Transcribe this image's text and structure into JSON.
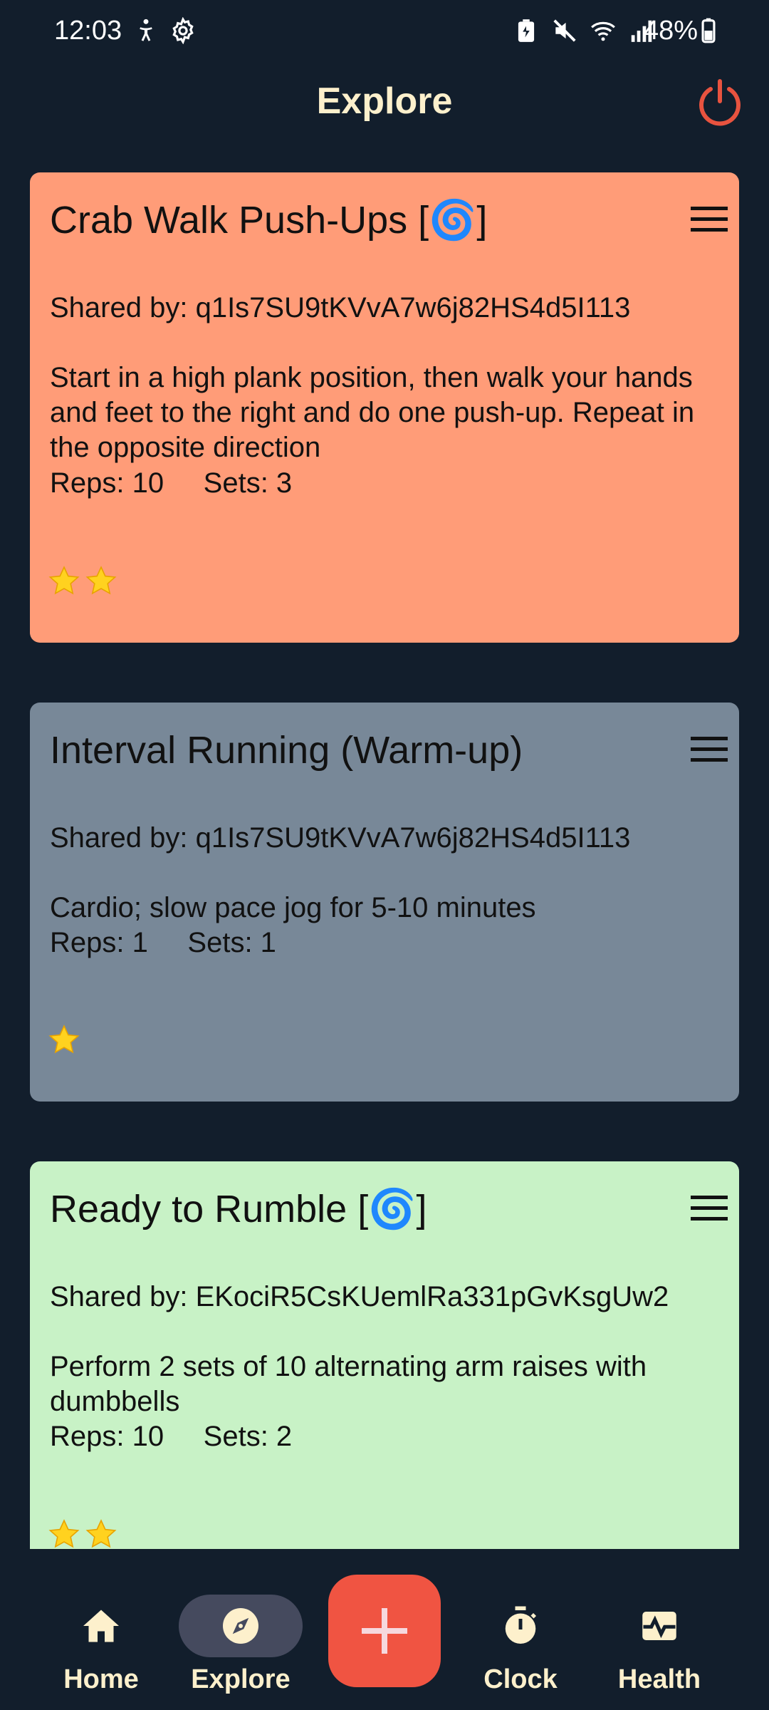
{
  "status_bar": {
    "time": "12:03",
    "battery": "48%",
    "icons": [
      "accessibility-icon",
      "settings-gear-icon",
      "battery-saver-icon",
      "mute-icon",
      "wifi-icon",
      "signal-icon",
      "battery-icon"
    ]
  },
  "header": {
    "title": "Explore",
    "power_icon": "power-icon",
    "power_color": "#e8533f"
  },
  "cards": [
    {
      "title": "Crab Walk Push-Ups [",
      "emoji": "🌀",
      "title_suffix": "]",
      "shared_by": "Shared by: q1Is7SU9tKVvA7w6j82HS4d5I113",
      "description": "Start in a high plank position, then walk your hands and feet to the right and do one push-up. Repeat in the opposite direction",
      "stats": "Reps: 10     Sets: 3",
      "stars": 2,
      "color": "#ff9c78"
    },
    {
      "title": "Interval Running (Warm-up)",
      "emoji": "",
      "title_suffix": "",
      "shared_by": "Shared by: q1Is7SU9tKVvA7w6j82HS4d5I113",
      "description": "Cardio; slow pace jog for 5-10 minutes",
      "stats": "Reps: 1     Sets: 1",
      "stars": 1,
      "color": "#788898"
    },
    {
      "title": "Ready to Rumble [",
      "emoji": "🌀",
      "title_suffix": "]",
      "shared_by": "Shared by: EKociR5CsKUemlRa331pGvKsgUw2",
      "description": "Perform 2 sets of 10 alternating arm raises with dumbbells",
      "stats": "Reps: 10     Sets: 2",
      "stars": 2,
      "color": "#c8f2c6"
    }
  ],
  "nav": {
    "items": [
      {
        "label": "Home",
        "icon": "home-icon",
        "active": false
      },
      {
        "label": "Explore",
        "icon": "compass-icon",
        "active": true
      },
      {
        "label": "Clock",
        "icon": "stopwatch-icon",
        "active": false
      },
      {
        "label": "Health",
        "icon": "health-icon",
        "active": false
      }
    ],
    "fab_icon": "plus-icon",
    "fab_color": "#f05442"
  }
}
